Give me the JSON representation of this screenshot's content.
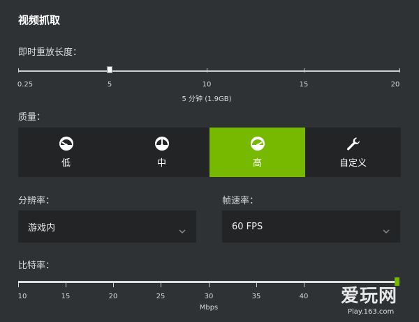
{
  "title": "视频抓取",
  "replay": {
    "label": "即时重放长度：",
    "ticks": [
      "0.25",
      "5",
      "10",
      "15",
      "20"
    ],
    "value_caption": "5 分钟 (1.9GB)",
    "value_minutes": 5
  },
  "quality": {
    "label": "质量：",
    "options": [
      {
        "label": "低",
        "icon": "gauge-low-icon"
      },
      {
        "label": "中",
        "icon": "gauge-medium-icon"
      },
      {
        "label": "高",
        "icon": "gauge-high-icon",
        "selected": true
      },
      {
        "label": "自定义",
        "icon": "wrench-icon"
      }
    ],
    "accent": "#76b900"
  },
  "resolution": {
    "label": "分辨率：",
    "value": "游戏内"
  },
  "framerate": {
    "label": "帧速率：",
    "value": "60 FPS"
  },
  "bitrate": {
    "label": "比特率：",
    "ticks": [
      "10",
      "15",
      "20",
      "25",
      "30",
      "35",
      "40"
    ],
    "unit": "Mbps",
    "value_mbps": 50
  },
  "watermark": {
    "main": "爱玩网",
    "sub": "Play.163.com"
  }
}
